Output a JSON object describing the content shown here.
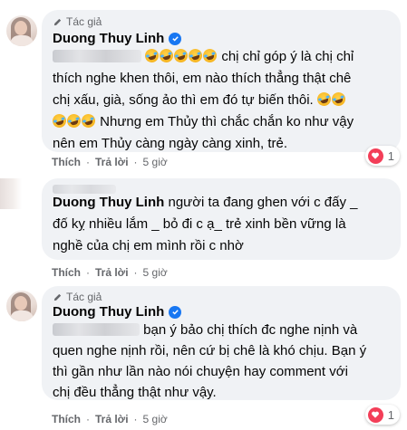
{
  "comments": [
    {
      "badge": "Tác giả",
      "author": "Duong Thuy Linh",
      "line1": "chị chỉ góp ý là chị chỉ",
      "line2": "thích nghe khen thôi, em nào thích thẳng thật chê",
      "line3": "chị xấu, già, sống ảo thì em đó tự biến thôi.",
      "line4": "Nhưng em Thủy thì chắc chắn ko như vậy",
      "line5": "nên em Thủy càng ngày càng xinh, trẻ.",
      "like": "Thích",
      "reply": "Trả lời",
      "time": "5 giờ",
      "reaction_count": "1"
    },
    {
      "author": "Duong Thuy Linh",
      "line1": "người ta đang ghen với c đấy _",
      "line2": "đố kỵ nhiều lắm _ bỏ đi c ạ_ trẻ xinh bền vững là",
      "line3": "nghề của chị em mình rồi c nhờ",
      "like": "Thích",
      "reply": "Trả lời",
      "time": "5 giờ"
    },
    {
      "badge": "Tác giả",
      "author": "Duong Thuy Linh",
      "line1": "bạn ý bảo chị thích đc nghe nịnh và",
      "line2": "quen nghe nịnh rồi, nên cứ bị chê là khó chịu. Bạn ý",
      "line3": "thì gần như lần nào nói chuyện hay comment với",
      "line4": "chị đều thẳng thật như vậy.",
      "like": "Thích",
      "reply": "Trả lời",
      "time": "5 giờ",
      "reaction_count": "1"
    }
  ],
  "colors": {
    "bubble_bg": "#f0f2f5",
    "meta_text": "#65676b",
    "verified_blue": "#1877f2",
    "heart_red": "#f33e58"
  },
  "icons": {
    "badge": "pen-icon",
    "verified": "verified-check-icon",
    "reaction": "heart-icon",
    "emoji": "rolling-laughing-emoji-icon"
  }
}
